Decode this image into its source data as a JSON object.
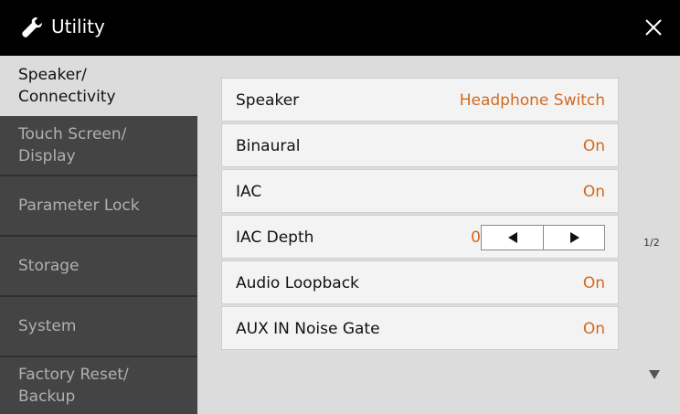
{
  "window": {
    "title": "Utility",
    "icon": "wrench-icon",
    "close_icon": "close-icon"
  },
  "sidebar": {
    "items": [
      {
        "label": "Speaker/\nConnectivity",
        "active": true
      },
      {
        "label": "Touch Screen/\nDisplay",
        "active": false
      },
      {
        "label": "Parameter Lock",
        "active": false
      },
      {
        "label": "Storage",
        "active": false
      },
      {
        "label": "System",
        "active": false
      },
      {
        "label": "Factory Reset/\nBackup",
        "active": false
      }
    ]
  },
  "settings": {
    "speaker": {
      "label": "Speaker",
      "value": "Headphone Switch"
    },
    "binaural": {
      "label": "Binaural",
      "value": "On"
    },
    "iac": {
      "label": "IAC",
      "value": "On"
    },
    "iac_depth": {
      "label": "IAC Depth",
      "value": "0"
    },
    "audio_loopback": {
      "label": "Audio Loopback",
      "value": "On"
    },
    "aux_in_noise_gate": {
      "label": "AUX IN Noise Gate",
      "value": "On"
    }
  },
  "page_indicator": "1/2",
  "colors": {
    "accent": "#d2691e",
    "titlebar": "#000000",
    "tab_inactive": "#444444"
  }
}
